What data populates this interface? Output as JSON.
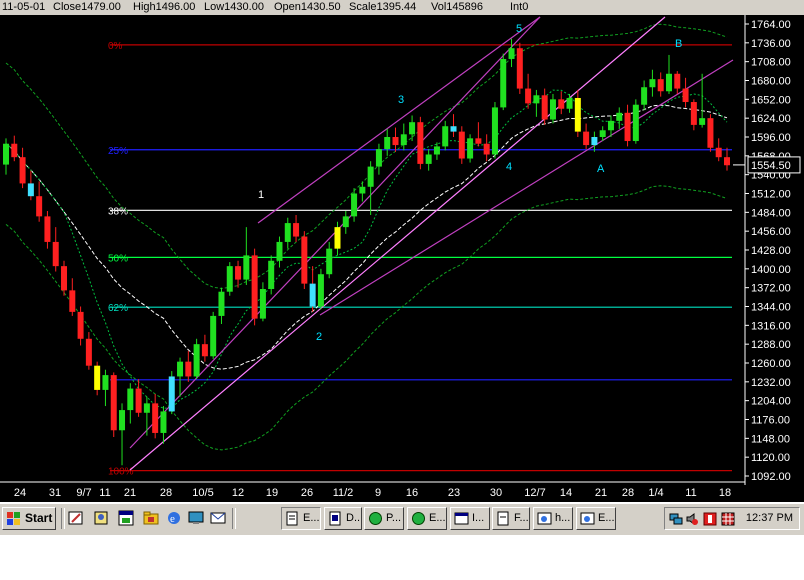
{
  "info_bar": {
    "date": "11-05-01",
    "close": "Close1479.00",
    "high": "High1496.00",
    "low": "Low1430.00",
    "open": "Open1430.50",
    "scale": "Scale1395.44",
    "vol": "Vol145896",
    "int": "Int0"
  },
  "chart_data": {
    "type": "candlestick",
    "y_axis_labels": [
      "1764.00",
      "1736.00",
      "1708.00",
      "1680.00",
      "1652.00",
      "1624.00",
      "1596.00",
      "1568.00",
      "1540.00",
      "1512.00",
      "1484.00",
      "1456.00",
      "1428.00",
      "1400.00",
      "1372.00",
      "1344.00",
      "1316.00",
      "1288.00",
      "1260.00",
      "1232.00",
      "1204.00",
      "1176.00",
      "1148.00",
      "1120.00",
      "1092.00"
    ],
    "ylim": [
      1092,
      1764
    ],
    "last_price": "1554.50",
    "x_tick_labels": [
      "24",
      "31",
      "9/7",
      "11",
      "21",
      "28",
      "10/5",
      "12",
      "19",
      "26",
      "11/2",
      "9",
      "16",
      "23",
      "30",
      "12/7",
      "14",
      "21",
      "28",
      "1/4",
      "11",
      "18"
    ],
    "fib_levels": [
      {
        "label": "0%",
        "price": 1733,
        "color": "#c00000"
      },
      {
        "label": "25%",
        "price": 1577,
        "color": "#2020ff"
      },
      {
        "label": "38%",
        "price": 1487,
        "color": "#ffffff"
      },
      {
        "label": "50%",
        "price": 1417,
        "color": "#00ff40"
      },
      {
        "label": "62%",
        "price": 1343,
        "color": "#00e0c0"
      },
      {
        "label": "",
        "price": 1235,
        "color": "#2020ff"
      },
      {
        "label": "100%",
        "price": 1100,
        "color": "#c00000"
      }
    ],
    "wave_labels": [
      {
        "label": "1",
        "color": "#ffffff"
      },
      {
        "label": "2",
        "color": "#00e0ff"
      },
      {
        "label": "3",
        "color": "#00e0ff"
      },
      {
        "label": "4",
        "color": "#00e0ff"
      },
      {
        "label": "5",
        "color": "#00e0ff"
      },
      {
        "label": "A",
        "color": "#00e0ff"
      },
      {
        "label": "B",
        "color": "#00e0ff"
      }
    ],
    "candles": [
      {
        "o": 1555,
        "h": 1594,
        "l": 1540,
        "c": 1586
      },
      {
        "o": 1586,
        "h": 1598,
        "l": 1560,
        "c": 1566
      },
      {
        "o": 1566,
        "h": 1580,
        "l": 1520,
        "c": 1527
      },
      {
        "o": 1527,
        "h": 1546,
        "l": 1502,
        "c": 1508
      },
      {
        "o": 1508,
        "h": 1530,
        "l": 1470,
        "c": 1478
      },
      {
        "o": 1478,
        "h": 1486,
        "l": 1430,
        "c": 1440
      },
      {
        "o": 1440,
        "h": 1462,
        "l": 1396,
        "c": 1404
      },
      {
        "o": 1404,
        "h": 1412,
        "l": 1360,
        "c": 1368
      },
      {
        "o": 1368,
        "h": 1386,
        "l": 1330,
        "c": 1336
      },
      {
        "o": 1336,
        "h": 1344,
        "l": 1286,
        "c": 1296
      },
      {
        "o": 1296,
        "h": 1306,
        "l": 1250,
        "c": 1256
      },
      {
        "o": 1256,
        "h": 1262,
        "l": 1212,
        "c": 1220
      },
      {
        "o": 1220,
        "h": 1250,
        "l": 1196,
        "c": 1242
      },
      {
        "o": 1242,
        "h": 1246,
        "l": 1150,
        "c": 1160
      },
      {
        "o": 1160,
        "h": 1200,
        "l": 1108,
        "c": 1190
      },
      {
        "o": 1190,
        "h": 1230,
        "l": 1170,
        "c": 1222
      },
      {
        "o": 1222,
        "h": 1236,
        "l": 1180,
        "c": 1186
      },
      {
        "o": 1186,
        "h": 1210,
        "l": 1152,
        "c": 1200
      },
      {
        "o": 1200,
        "h": 1214,
        "l": 1148,
        "c": 1156
      },
      {
        "o": 1156,
        "h": 1196,
        "l": 1140,
        "c": 1188
      },
      {
        "o": 1188,
        "h": 1248,
        "l": 1184,
        "c": 1240
      },
      {
        "o": 1240,
        "h": 1268,
        "l": 1210,
        "c": 1262
      },
      {
        "o": 1262,
        "h": 1278,
        "l": 1232,
        "c": 1240
      },
      {
        "o": 1240,
        "h": 1296,
        "l": 1236,
        "c": 1288
      },
      {
        "o": 1288,
        "h": 1302,
        "l": 1262,
        "c": 1270
      },
      {
        "o": 1270,
        "h": 1336,
        "l": 1266,
        "c": 1330
      },
      {
        "o": 1330,
        "h": 1372,
        "l": 1318,
        "c": 1366
      },
      {
        "o": 1366,
        "h": 1410,
        "l": 1360,
        "c": 1404
      },
      {
        "o": 1404,
        "h": 1412,
        "l": 1372,
        "c": 1384
      },
      {
        "o": 1384,
        "h": 1462,
        "l": 1376,
        "c": 1420
      },
      {
        "o": 1420,
        "h": 1430,
        "l": 1316,
        "c": 1326
      },
      {
        "o": 1326,
        "h": 1380,
        "l": 1322,
        "c": 1370
      },
      {
        "o": 1370,
        "h": 1420,
        "l": 1362,
        "c": 1412
      },
      {
        "o": 1412,
        "h": 1448,
        "l": 1402,
        "c": 1440
      },
      {
        "o": 1440,
        "h": 1476,
        "l": 1430,
        "c": 1468
      },
      {
        "o": 1468,
        "h": 1480,
        "l": 1440,
        "c": 1448
      },
      {
        "o": 1448,
        "h": 1456,
        "l": 1370,
        "c": 1378
      },
      {
        "o": 1378,
        "h": 1404,
        "l": 1336,
        "c": 1344
      },
      {
        "o": 1344,
        "h": 1400,
        "l": 1340,
        "c": 1392
      },
      {
        "o": 1392,
        "h": 1440,
        "l": 1386,
        "c": 1430
      },
      {
        "o": 1430,
        "h": 1470,
        "l": 1420,
        "c": 1462
      },
      {
        "o": 1462,
        "h": 1486,
        "l": 1452,
        "c": 1478
      },
      {
        "o": 1478,
        "h": 1520,
        "l": 1470,
        "c": 1512
      },
      {
        "o": 1512,
        "h": 1530,
        "l": 1500,
        "c": 1522
      },
      {
        "o": 1522,
        "h": 1560,
        "l": 1480,
        "c": 1552
      },
      {
        "o": 1552,
        "h": 1586,
        "l": 1540,
        "c": 1578
      },
      {
        "o": 1578,
        "h": 1608,
        "l": 1568,
        "c": 1596
      },
      {
        "o": 1596,
        "h": 1610,
        "l": 1574,
        "c": 1584
      },
      {
        "o": 1584,
        "h": 1616,
        "l": 1576,
        "c": 1600
      },
      {
        "o": 1600,
        "h": 1628,
        "l": 1590,
        "c": 1618
      },
      {
        "o": 1618,
        "h": 1626,
        "l": 1548,
        "c": 1556
      },
      {
        "o": 1556,
        "h": 1578,
        "l": 1546,
        "c": 1570
      },
      {
        "o": 1570,
        "h": 1588,
        "l": 1562,
        "c": 1582
      },
      {
        "o": 1582,
        "h": 1620,
        "l": 1576,
        "c": 1612
      },
      {
        "o": 1612,
        "h": 1630,
        "l": 1596,
        "c": 1604
      },
      {
        "o": 1604,
        "h": 1612,
        "l": 1556,
        "c": 1564
      },
      {
        "o": 1564,
        "h": 1600,
        "l": 1558,
        "c": 1594
      },
      {
        "o": 1594,
        "h": 1618,
        "l": 1582,
        "c": 1586
      },
      {
        "o": 1586,
        "h": 1600,
        "l": 1560,
        "c": 1570
      },
      {
        "o": 1570,
        "h": 1648,
        "l": 1564,
        "c": 1640
      },
      {
        "o": 1640,
        "h": 1720,
        "l": 1636,
        "c": 1712
      },
      {
        "o": 1712,
        "h": 1742,
        "l": 1700,
        "c": 1728
      },
      {
        "o": 1728,
        "h": 1736,
        "l": 1660,
        "c": 1668
      },
      {
        "o": 1668,
        "h": 1690,
        "l": 1638,
        "c": 1646
      },
      {
        "o": 1646,
        "h": 1666,
        "l": 1626,
        "c": 1658
      },
      {
        "o": 1658,
        "h": 1668,
        "l": 1614,
        "c": 1622
      },
      {
        "o": 1622,
        "h": 1660,
        "l": 1616,
        "c": 1652
      },
      {
        "o": 1652,
        "h": 1664,
        "l": 1630,
        "c": 1638
      },
      {
        "o": 1638,
        "h": 1660,
        "l": 1632,
        "c": 1654
      },
      {
        "o": 1654,
        "h": 1666,
        "l": 1596,
        "c": 1604
      },
      {
        "o": 1604,
        "h": 1616,
        "l": 1578,
        "c": 1584
      },
      {
        "o": 1584,
        "h": 1604,
        "l": 1574,
        "c": 1596
      },
      {
        "o": 1596,
        "h": 1612,
        "l": 1590,
        "c": 1606
      },
      {
        "o": 1606,
        "h": 1628,
        "l": 1596,
        "c": 1620
      },
      {
        "o": 1620,
        "h": 1640,
        "l": 1608,
        "c": 1632
      },
      {
        "o": 1632,
        "h": 1644,
        "l": 1582,
        "c": 1590
      },
      {
        "o": 1590,
        "h": 1652,
        "l": 1586,
        "c": 1644
      },
      {
        "o": 1644,
        "h": 1680,
        "l": 1636,
        "c": 1670
      },
      {
        "o": 1670,
        "h": 1696,
        "l": 1656,
        "c": 1682
      },
      {
        "o": 1682,
        "h": 1692,
        "l": 1656,
        "c": 1664
      },
      {
        "o": 1664,
        "h": 1718,
        "l": 1660,
        "c": 1690
      },
      {
        "o": 1690,
        "h": 1694,
        "l": 1660,
        "c": 1668
      },
      {
        "o": 1668,
        "h": 1684,
        "l": 1640,
        "c": 1648
      },
      {
        "o": 1648,
        "h": 1652,
        "l": 1606,
        "c": 1614
      },
      {
        "o": 1614,
        "h": 1690,
        "l": 1610,
        "c": 1624
      },
      {
        "o": 1624,
        "h": 1630,
        "l": 1574,
        "c": 1580
      },
      {
        "o": 1580,
        "h": 1594,
        "l": 1560,
        "c": 1566
      },
      {
        "o": 1566,
        "h": 1580,
        "l": 1546,
        "c": 1554
      }
    ]
  },
  "taskbar": {
    "start_label": "Start",
    "tasks": [
      "E...",
      "D...",
      "P...",
      "E...",
      "I...",
      "F...",
      "h...",
      "E..."
    ],
    "clock": "12:37 PM"
  }
}
